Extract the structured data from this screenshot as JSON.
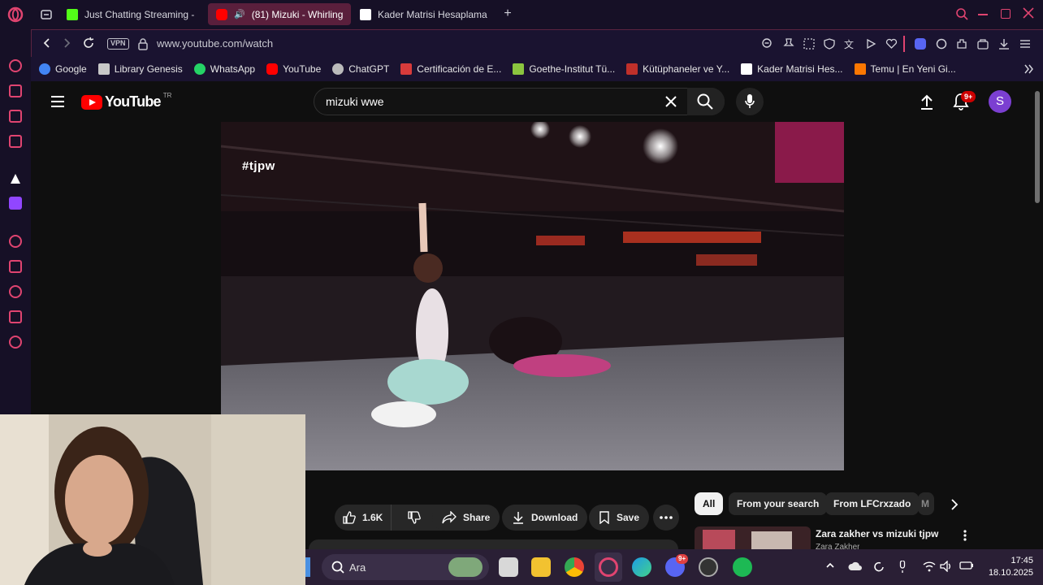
{
  "browser": {
    "tabs": [
      {
        "label": "Just Chatting Streaming -",
        "icon": "kick-icon",
        "color": "#53fc18"
      },
      {
        "label": "(81) Mizuki - Whirling",
        "icon": "youtube-icon",
        "color": "#ff0000",
        "active": true
      },
      {
        "label": "Kader Matrisi Hesaplama",
        "icon": "page-icon",
        "color": "#ffffff"
      }
    ],
    "new_tab_symbol": "+",
    "address": "www.youtube.com/watch",
    "vpn_label": "VPN",
    "bookmarks": [
      {
        "label": "Google",
        "icon": "google-icon",
        "color": "#4285f4"
      },
      {
        "label": "Library Genesis",
        "icon": "book-icon",
        "color": "#c8c8c8"
      },
      {
        "label": "WhatsApp",
        "icon": "whatsapp-icon",
        "color": "#25d366"
      },
      {
        "label": "YouTube",
        "icon": "youtube-icon",
        "color": "#ff0000"
      },
      {
        "label": "ChatGPT",
        "icon": "chatgpt-icon",
        "color": "#bbbbbb"
      },
      {
        "label": "Certificación de E...",
        "icon": "cert-icon",
        "color": "#d83b3b"
      },
      {
        "label": "Goethe-Institut Tü...",
        "icon": "goethe-icon",
        "color": "#8bc53f"
      },
      {
        "label": "Kütüphaneler ve Y...",
        "icon": "library-icon",
        "color": "#c0302a"
      },
      {
        "label": "Kader Matrisi Hes...",
        "icon": "page-icon",
        "color": "#ffffff"
      },
      {
        "label": "Temu | En Yeni Gi...",
        "icon": "temu-icon",
        "color": "#fb7701"
      }
    ]
  },
  "youtube": {
    "logo_text": "YouTube",
    "region": "TR",
    "search_query": "mizuki wwe",
    "notification_badge": "9+",
    "avatar_letter": "S",
    "video_overlay_tag": "#tjpw",
    "actions": {
      "likes": "1.6K",
      "share": "Share",
      "download": "Download",
      "save": "Save"
    },
    "chips": [
      "All",
      "From your search",
      "From LFCrxzado",
      "M"
    ],
    "recommended": {
      "title": "Zara zakher vs mizuki tjpw",
      "channel": "Zara Zakher"
    }
  },
  "taskbar": {
    "search_placeholder": "Ara",
    "time": "17:45",
    "date": "18.10.2025",
    "discord_badge": "9+"
  },
  "colors": {
    "opera_red": "#e04470",
    "youtube_red": "#ff0000",
    "avatar_purple": "#7b3fd1"
  }
}
